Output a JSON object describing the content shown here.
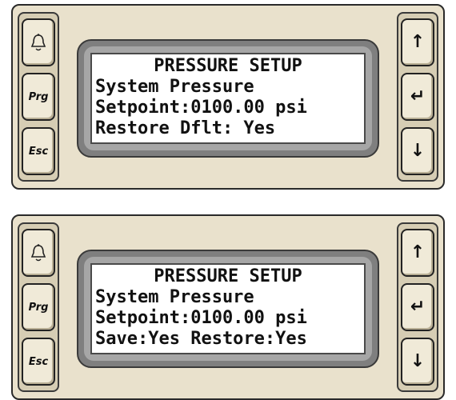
{
  "panels": [
    {
      "lcd": {
        "line1": "PRESSURE SETUP",
        "line2": "System Pressure",
        "line3": "Setpoint:0100.00 psi",
        "line4": "Restore Dflt: Yes"
      },
      "left_keys": {
        "alarm_icon": "bell-icon",
        "prg_label": "Prg",
        "esc_label": "Esc"
      },
      "right_keys": {
        "up": "↑",
        "enter": "↵",
        "down": "↓"
      }
    },
    {
      "lcd": {
        "line1": "PRESSURE SETUP",
        "line2": "System Pressure",
        "line3": "Setpoint:0100.00 psi",
        "line4": "Save:Yes Restore:Yes"
      },
      "left_keys": {
        "alarm_icon": "bell-icon",
        "prg_label": "Prg",
        "esc_label": "Esc"
      },
      "right_keys": {
        "up": "↑",
        "enter": "↵",
        "down": "↓"
      }
    }
  ]
}
